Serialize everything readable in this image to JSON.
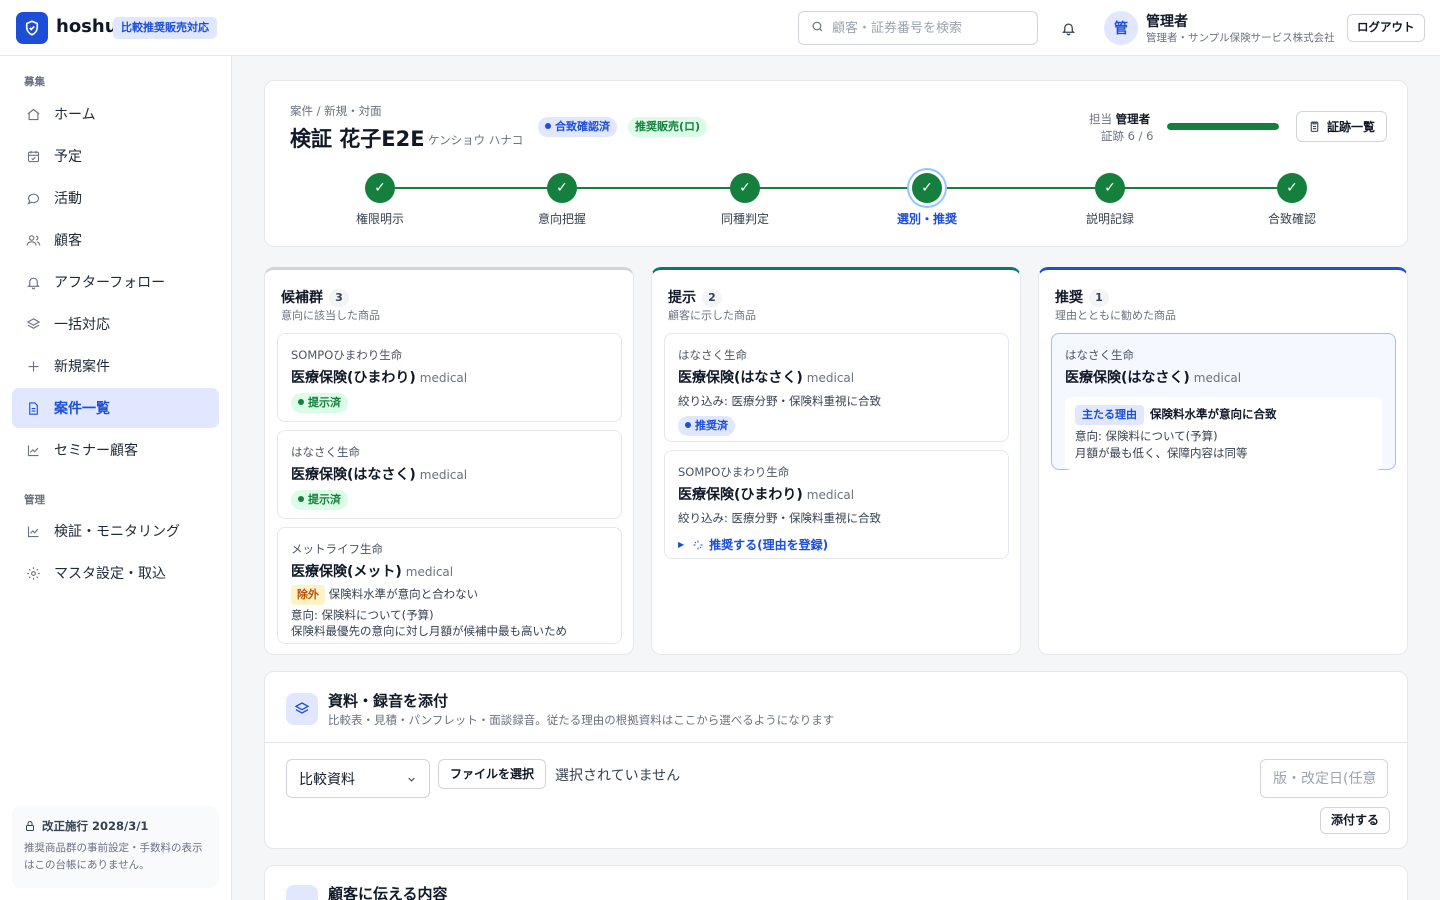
{
  "header": {
    "brand": "hoshu",
    "brand_badge": "比較推奨販売対応",
    "search_placeholder": "顧客・証券番号を検索",
    "avatar_initial": "管",
    "user_name": "管理者",
    "user_sub": "管理者・サンプル保険サービス株式会社",
    "logout": "ログアウト"
  },
  "sidebar": {
    "section_recruit": "募集",
    "items": [
      {
        "label": "ホーム",
        "icon": "home-icon"
      },
      {
        "label": "予定",
        "icon": "calendar-icon"
      },
      {
        "label": "活動",
        "icon": "chat-icon"
      },
      {
        "label": "顧客",
        "icon": "users-icon"
      },
      {
        "label": "アフターフォロー",
        "icon": "bell-icon"
      },
      {
        "label": "一括対応",
        "icon": "layers-icon"
      },
      {
        "label": "新規案件",
        "icon": "plus-icon"
      },
      {
        "label": "案件一覧",
        "icon": "document-icon"
      },
      {
        "label": "セミナー顧客",
        "icon": "chart-icon"
      }
    ],
    "section_admin": "管理",
    "admin_items": [
      {
        "label": "検証・モニタリング",
        "icon": "chart-icon"
      },
      {
        "label": "マスタ設定・取込",
        "icon": "gear-icon"
      }
    ],
    "note_title": "改正施行 2028/3/1",
    "note_body": "推奨商品群の事前設定・手数料の表示はこの台帳にありません。"
  },
  "case": {
    "breadcrumb": "案件 / 新規・対面",
    "name": "検証 花子E2E",
    "kana": "ケンショウ ハナコ",
    "status_agree": "合致確認済",
    "status_recommend": "推奨販売(ロ)",
    "owner_label": "担当",
    "owner_name": "管理者",
    "proof_label": "証跡 6 / 6",
    "proof_done": 6,
    "proof_total": 6,
    "proof_button": "証跡一覧",
    "steps": [
      "権限明示",
      "意向把握",
      "同種判定",
      "選別・推奨",
      "説明記録",
      "合致確認"
    ],
    "current_step": 3
  },
  "columns": {
    "candidates": {
      "title": "候補群",
      "count": "3",
      "sub": "意向に該当した商品",
      "items": [
        {
          "company": "SOMPOひまわり生命",
          "product": "医療保険(ひまわり)",
          "type": "medical",
          "tag": "提示済"
        },
        {
          "company": "はなさく生命",
          "product": "医療保険(はなさく)",
          "type": "medical",
          "tag": "提示済"
        },
        {
          "company": "メットライフ生命",
          "product": "医療保険(メット)",
          "type": "medical",
          "exclude_tag": "除外",
          "exclude_reason": "保険料水準が意向と合わない",
          "intent": "意向: 保険料について(予算)",
          "detail": "保険料最優先の意向に対し月額が候補中最も高いため"
        }
      ]
    },
    "presented": {
      "title": "提示",
      "count": "2",
      "sub": "顧客に示した商品",
      "items": [
        {
          "company": "はなさく生命",
          "product": "医療保険(はなさく)",
          "type": "medical",
          "filter": "絞り込み: 医療分野・保険料重視に合致",
          "tag": "推奨済"
        },
        {
          "company": "SOMPOひまわり生命",
          "product": "医療保険(ひまわり)",
          "type": "medical",
          "filter": "絞り込み: 医療分野・保険料重視に合致",
          "action": "推奨する(理由を登録)"
        }
      ]
    },
    "recommended": {
      "title": "推奨",
      "count": "1",
      "sub": "理由とともに勧めた商品",
      "items": [
        {
          "company": "はなさく生命",
          "product": "医療保険(はなさく)",
          "type": "medical",
          "reason_tag": "主たる理由",
          "reason": "保険料水準が意向に合致",
          "intent": "意向: 保険料について(予算)",
          "detail": "月額が最も低く、保障内容は同等"
        }
      ]
    }
  },
  "attach": {
    "title": "資料・録音を添付",
    "sub": "比較表・見積・パンフレット・面談録音。従たる理由の根拠資料はここから選べるようになります",
    "select_value": "比較資料",
    "file_button": "ファイルを選択",
    "file_none": "選択されていません",
    "version_placeholder": "版・改定日(任意)",
    "submit": "添付する"
  },
  "tell": {
    "title": "顧客に伝える内容"
  },
  "colors": {
    "accent": "#1d4ed8",
    "success": "#15803d",
    "teal": "#0f766e"
  }
}
